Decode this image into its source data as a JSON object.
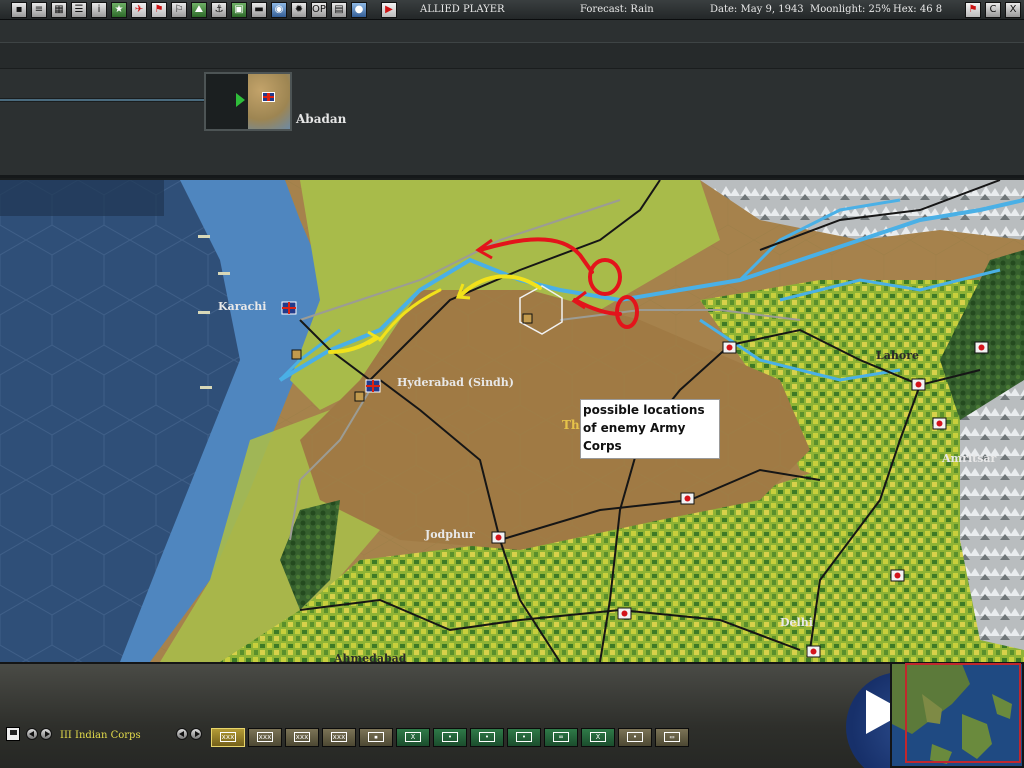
{
  "toolbar": {
    "buttons": [
      {
        "id": "menu",
        "icon": "square-icon",
        "glyph": "▪"
      },
      {
        "id": "orders",
        "icon": "document-icon",
        "glyph": "≡"
      },
      {
        "id": "calendar",
        "icon": "grid-icon",
        "glyph": "▦"
      },
      {
        "id": "events",
        "icon": "list-icon",
        "glyph": "☰"
      },
      {
        "id": "info",
        "icon": "info-icon",
        "glyph": "i"
      },
      {
        "id": "star",
        "icon": "star-icon",
        "glyph": "★"
      },
      {
        "id": "air",
        "icon": "plane-icon",
        "glyph": "✈"
      },
      {
        "id": "red-flag",
        "icon": "red-flag-icon",
        "glyph": "⚑"
      },
      {
        "id": "flag",
        "icon": "flag-icon",
        "glyph": "⚐"
      },
      {
        "id": "mountain",
        "icon": "mountain-icon",
        "glyph": "⛰"
      },
      {
        "id": "ships",
        "icon": "ship-icon",
        "glyph": "⚓"
      },
      {
        "id": "base",
        "icon": "base-icon",
        "glyph": "▣"
      },
      {
        "id": "land",
        "icon": "tank-icon",
        "glyph": "▬"
      },
      {
        "id": "globe",
        "icon": "globe-icon",
        "glyph": "◉"
      },
      {
        "id": "resources",
        "icon": "cog-icon",
        "glyph": "✹"
      },
      {
        "id": "op",
        "icon": "op-icon",
        "glyph": "OP"
      },
      {
        "id": "reports",
        "icon": "report-icon",
        "glyph": "▤"
      },
      {
        "id": "weather",
        "icon": "cloud-icon",
        "glyph": "●"
      },
      {
        "id": "end-turn",
        "icon": "play-icon",
        "glyph": "▶"
      }
    ],
    "player": "ALLIED PLAYER",
    "forecast": "Forecast: Rain",
    "date": "Date: May 9, 1943",
    "moonlight": "Moonlight: 25%",
    "hex": "Hex: 46  8",
    "right_buttons": [
      {
        "id": "flag-right",
        "icon": "red-flag-icon",
        "glyph": "⚑"
      },
      {
        "id": "c",
        "icon": "c-icon",
        "glyph": "C"
      },
      {
        "id": "close",
        "icon": "close-icon",
        "glyph": "X"
      }
    ]
  },
  "hq": {
    "name": "Abadan"
  },
  "map": {
    "cities": [
      {
        "name": "Karachi"
      },
      {
        "name": "Hyderabad (Sindh)"
      },
      {
        "name": "Jodphur"
      },
      {
        "name": "Lahore"
      },
      {
        "name": "Amritsar"
      },
      {
        "name": "Delhi"
      },
      {
        "name": "Ahmedabad"
      }
    ],
    "note": "possible locations of enemy Army Corps",
    "note_fragment": "Th",
    "annotation_colors": {
      "red": "#e3141b",
      "yellow": "#f2e21a"
    }
  },
  "bottom": {
    "unit_name": "III Indian Corps",
    "filters": [
      {
        "style": "sel",
        "label": "xxx"
      },
      {
        "style": "tan",
        "label": "xxx"
      },
      {
        "style": "tan",
        "label": "xxx"
      },
      {
        "style": "tan",
        "label": "xxx"
      },
      {
        "style": "tan",
        "label": "▪"
      },
      {
        "style": "grn",
        "label": "X"
      },
      {
        "style": "grn",
        "label": "•"
      },
      {
        "style": "grn",
        "label": "•"
      },
      {
        "style": "grn",
        "label": "•"
      },
      {
        "style": "grn",
        "label": "∞"
      },
      {
        "style": "grn",
        "label": "X"
      },
      {
        "style": "tan",
        "label": "•"
      },
      {
        "style": "tan",
        "label": "▭"
      }
    ]
  }
}
